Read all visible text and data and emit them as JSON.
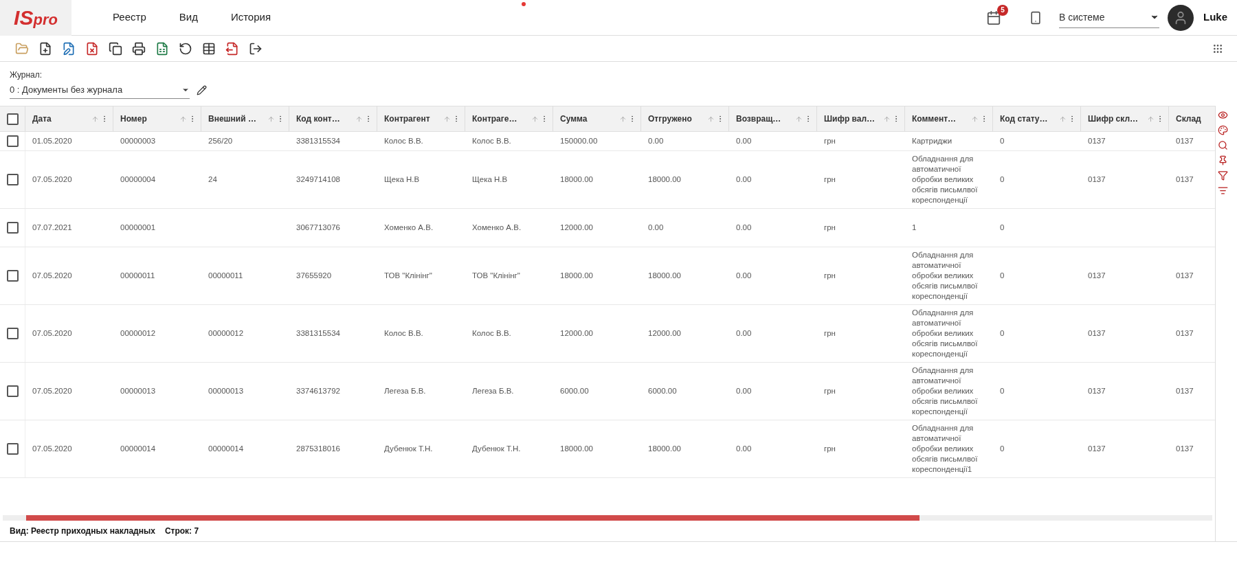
{
  "logo": {
    "text_1": "IS",
    "text_2": "pro"
  },
  "menu": [
    "Реестр",
    "Вид",
    "История"
  ],
  "header": {
    "calendar_badge": "5",
    "status_select": "В системе",
    "user": "Luke"
  },
  "journal": {
    "label": "Журнал:",
    "value": "0 : Документы без журнала"
  },
  "table": {
    "select_all_checked": false,
    "columns": [
      "Дата",
      "Номер",
      "Внешний …",
      "Код конт…",
      "Контрагент",
      "Контраге…",
      "Сумма",
      "Отгружено",
      "Возвращ…",
      "Шифр вал…",
      "Коммент…",
      "Код стату…",
      "Шифр скл…",
      "Склад"
    ],
    "rows": [
      {
        "checked": false,
        "cells": [
          "01.05.2020",
          "00000003",
          "256/20",
          "3381315534",
          "Колос В.В.",
          "Колос В.В.",
          "150000.00",
          "0.00",
          "0.00",
          "грн",
          "Картриджи",
          "0",
          "0137",
          "0137"
        ]
      },
      {
        "checked": false,
        "cells": [
          "07.05.2020",
          "00000004",
          "24",
          "3249714108",
          "Щека Н.В",
          "Щека Н.В",
          "18000.00",
          "18000.00",
          "0.00",
          "грн",
          "Обладнання для автоматичної обробки великих обсягів письмлвої кореспонденції",
          "0",
          "0137",
          "0137"
        ]
      },
      {
        "checked": false,
        "cells": [
          "07.07.2021",
          "00000001",
          null,
          "3067713076",
          "Хоменко А.В.",
          "Хоменко А.В.",
          "12000.00",
          "0.00",
          "0.00",
          "грн",
          "1",
          "0",
          null,
          null
        ]
      },
      {
        "checked": false,
        "cells": [
          "07.05.2020",
          "00000011",
          "00000011",
          "37655920",
          "ТОВ \"Клінінг\"",
          "ТОВ \"Клінінг\"",
          "18000.00",
          "18000.00",
          "0.00",
          "грн",
          "Обладнання для автоматичної обробки великих обсягів письмлвої кореспонденції",
          "0",
          "0137",
          "0137"
        ]
      },
      {
        "checked": false,
        "cells": [
          "07.05.2020",
          "00000012",
          "00000012",
          "3381315534",
          "Колос В.В.",
          "Колос В.В.",
          "12000.00",
          "12000.00",
          "0.00",
          "грн",
          "Обладнання для автоматичної обробки великих обсягів письмлвої кореспонденції",
          "0",
          "0137",
          "0137"
        ]
      },
      {
        "checked": false,
        "cells": [
          "07.05.2020",
          "00000013",
          "00000013",
          "3374613792",
          "Легеза Б.В.",
          "Легеза Б.В.",
          "6000.00",
          "6000.00",
          "0.00",
          "грн",
          "Обладнання для автоматичної обробки великих обсягів письмлвої кореспонденції",
          "0",
          "0137",
          "0137"
        ]
      },
      {
        "checked": false,
        "cells": [
          "07.05.2020",
          "00000014",
          "00000014",
          "2875318016",
          "Дубенюк Т.Н.",
          "Дубенюк Т.Н.",
          "18000.00",
          "18000.00",
          "0.00",
          "грн",
          "Обладнання для автоматичної обробки великих обсягів письмлвої кореспонденції1",
          "0",
          "0137",
          "0137"
        ]
      }
    ]
  },
  "status_bar": {
    "view": "Вид: Реестр приходных накладных",
    "rows": "Строк: 7"
  }
}
